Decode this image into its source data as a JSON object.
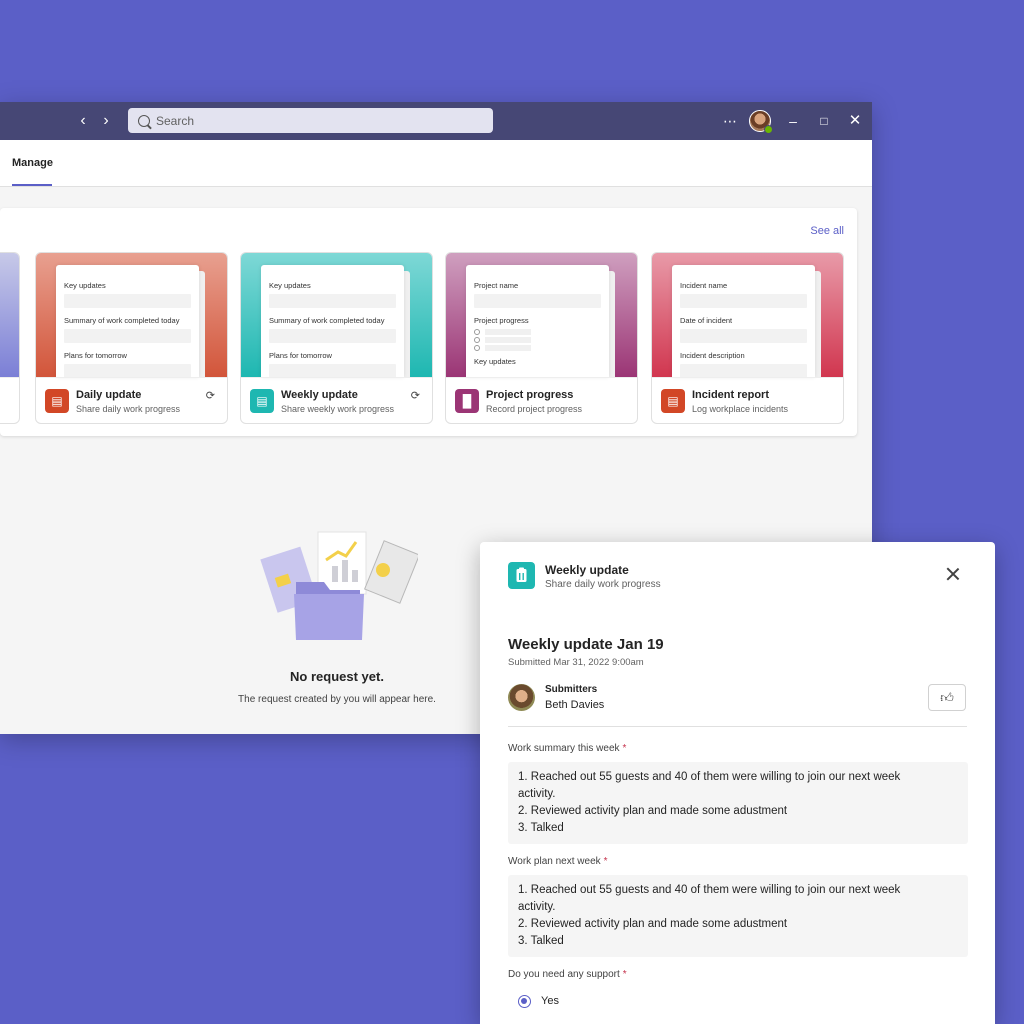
{
  "window": {
    "search_placeholder": "Search",
    "tab_manage": "Manage"
  },
  "templates": {
    "see_all": "See all",
    "cards": [
      {
        "title": "Daily update",
        "subtitle": "Share daily work progress",
        "fields": [
          "Key updates",
          "Summary of work completed today",
          "Plans for tomorrow"
        ],
        "color": "#d24726"
      },
      {
        "title": "Weekly update",
        "subtitle": "Share weekly work progress",
        "fields": [
          "Key updates",
          "Summary of work completed today",
          "Plans for tomorrow"
        ],
        "color": "#1eb7b1"
      },
      {
        "title": "Project progress",
        "subtitle": "Record project progress",
        "fields": [
          "Project name",
          "Project progress",
          "Key updates"
        ],
        "color": "#9b3575"
      },
      {
        "title": "Incident report",
        "subtitle": "Log workplace incidents",
        "fields": [
          "Incident name",
          "Date of incident",
          "Incident description"
        ],
        "color": "#d24726"
      }
    ]
  },
  "empty_state": {
    "title": "No request yet.",
    "subtitle": "The request created by you will appear here."
  },
  "panel": {
    "app_title": "Weekly update",
    "app_subtitle": "Share daily work progress",
    "heading": "Weekly update Jan 19",
    "submitted": "Submitted Mar 31, 2022 9:00am",
    "submitters_label": "Submitters",
    "submitter_name": "Beth Davies",
    "q1_label": "Work summary this week",
    "q1_lines": [
      "1. Reached out 55 guests and 40 of them were willing to join our next week",
      "activity.",
      "2. Reviewed activity plan and made some adustment",
      "3. Talked"
    ],
    "q2_label": "Work plan next week",
    "q2_lines": [
      "1. Reached out 55 guests and 40 of them were willing to join our next week",
      "activity.",
      "2. Reviewed activity plan and made some adustment",
      "3. Talked"
    ],
    "q3_label": "Do you need any support",
    "q3_answer": "Yes",
    "required_mark": "*"
  }
}
